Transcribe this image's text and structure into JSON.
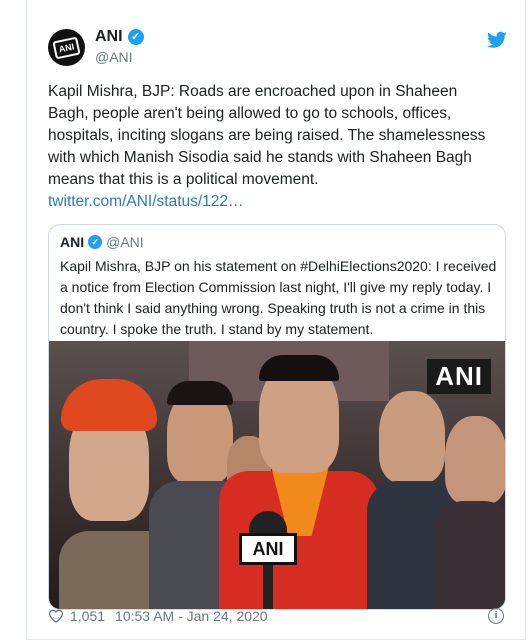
{
  "tweet": {
    "author_name": "ANI",
    "author_handle": "@ANI",
    "avatar_text": "ANI",
    "text": "Kapil Mishra, BJP: Roads are encroached upon in Shaheen Bagh, people aren't being allowed to go to schools, offices, hospitals, inciting slogans are being raised. The shamelessness with which Manish Sisodia said he stands with Shaheen Bagh means that this is a political movement.",
    "link": "twitter.com/ANI/status/122…",
    "likes": "1,051",
    "timestamp": "10:53 AM - Jan 24, 2020"
  },
  "quote": {
    "author_name": "ANI",
    "author_handle": "@ANI",
    "text": "Kapil Mishra, BJP on his statement on #DelhiElections2020: I received a notice from Election Commission last night, I'll give my reply today. I don't think I said anything wrong. Speaking truth is not a crime in this country. I spoke the truth. I stand by my statement.",
    "image_watermark": "ANI",
    "mic_label": "ANI"
  },
  "colors": {
    "link": "#2b7bb9",
    "verified": "#1da1f2",
    "muted": "#697882",
    "text": "#1c2022"
  },
  "icons": [
    "verified-badge-icon",
    "twitter-bird-icon",
    "heart-icon",
    "info-icon"
  ]
}
